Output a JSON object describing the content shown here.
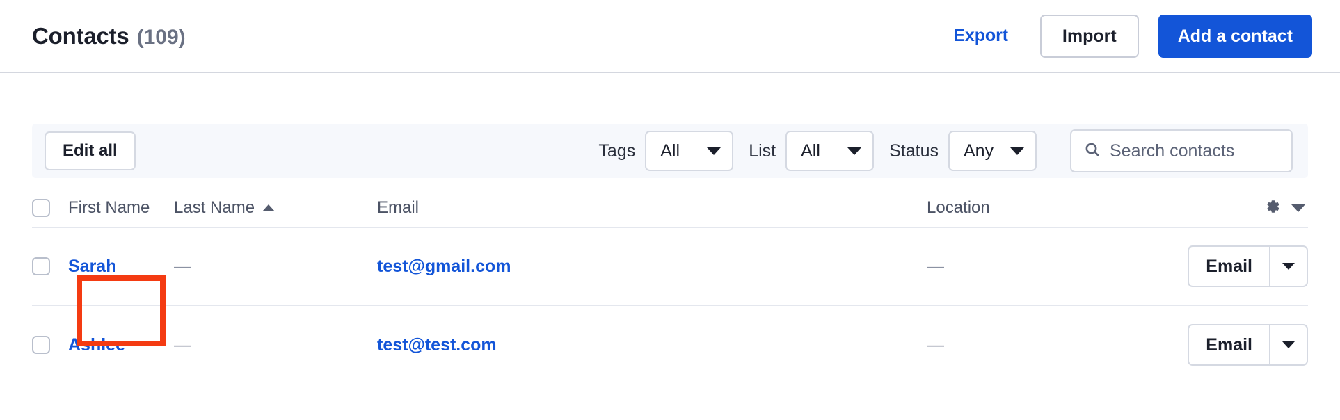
{
  "header": {
    "title": "Contacts",
    "count": "(109)",
    "export_label": "Export",
    "import_label": "Import",
    "add_contact_label": "Add a contact"
  },
  "filter_bar": {
    "edit_all_label": "Edit all",
    "filters": [
      {
        "label": "Tags",
        "value": "All",
        "name": "tags"
      },
      {
        "label": "List",
        "value": "All",
        "name": "list"
      },
      {
        "label": "Status",
        "value": "Any",
        "name": "status"
      }
    ],
    "search": {
      "placeholder": "Search contacts",
      "value": "",
      "icon": "search-icon"
    }
  },
  "table": {
    "columns": {
      "first_name": "First Name",
      "last_name": "Last Name",
      "email": "Email",
      "location": "Location"
    },
    "sort": {
      "column": "Last Name",
      "direction": "ascending"
    },
    "settings_icon": "gear-icon",
    "settings_caret": "chevron-down-icon",
    "rows": [
      {
        "first_name": "Sarah",
        "last_name": "—",
        "email": "test@gmail.com",
        "location": "—",
        "action_label": "Email",
        "highlighted": true
      },
      {
        "first_name": "Ashlee",
        "last_name": "—",
        "email": "test@test.com",
        "location": "—",
        "action_label": "Email",
        "highlighted": false
      }
    ]
  },
  "colors": {
    "accent_blue": "#1355d8",
    "highlight_red": "#f43b12",
    "filter_bar_bg": "#f6f8fc",
    "muted_text": "#6a7183"
  }
}
